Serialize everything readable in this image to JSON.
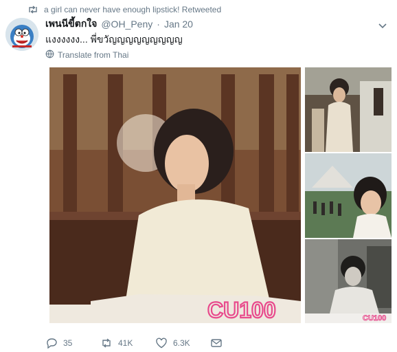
{
  "retweet": {
    "text": "a girl can never have enough lipstick! Retweeted"
  },
  "tweet": {
    "display_name": "เพนนีขี้ตกใจ",
    "handle": "@OH_Peny",
    "separator": "·",
    "date": "Jan 20",
    "text": "แงงงงงง... พี่ขวัญญญญญญญญญ",
    "translate": "Translate from Thai"
  },
  "media": {
    "watermark_large": "CU100",
    "watermark_small": "CU100"
  },
  "actions": {
    "replies": "35",
    "retweets": "41K",
    "likes": "6.3K"
  },
  "colors": {
    "secondary_text": "#657786",
    "watermark": "#e84a8c"
  },
  "icons": [
    "retweet-icon",
    "chevron-down-icon",
    "globe-icon",
    "reply-icon",
    "heart-icon",
    "mail-icon"
  ]
}
